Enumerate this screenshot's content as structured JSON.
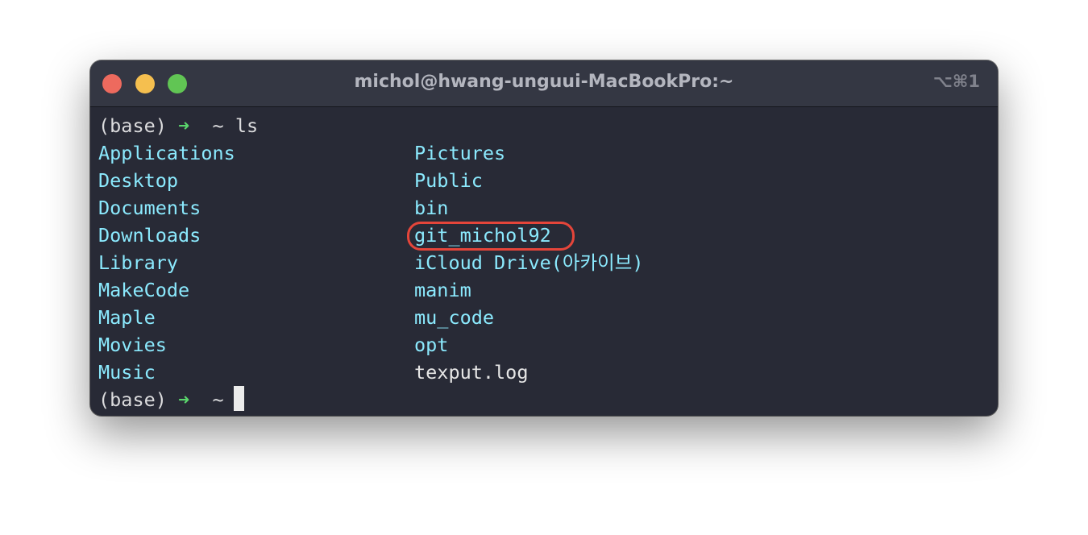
{
  "window": {
    "title": "michol@hwang-unguui-MacBookPro:~",
    "shortcut": "⌥⌘1"
  },
  "colors": {
    "background": "#282a36",
    "titlebar": "#343743",
    "directory": "#8be9fd",
    "file": "#e6e6e6",
    "prompt_arrow": "#5ad66c",
    "highlight_ring": "#e5453a",
    "traffic_close": "#ed6a5e",
    "traffic_minimize": "#f5bf4f",
    "traffic_maximize": "#61c554"
  },
  "session": {
    "prompt_env": "(base)",
    "prompt_arrow": "➜",
    "prompt_dir": "~",
    "command": "ls"
  },
  "listing": {
    "left": [
      "Applications",
      "Desktop",
      "Documents",
      "Downloads",
      "Library",
      "MakeCode",
      "Maple",
      "Movies",
      "Music"
    ],
    "right": [
      "Pictures",
      "Public",
      "bin",
      "git_michol92",
      "iCloud Drive(아카이브)",
      "manim",
      "mu_code",
      "opt",
      "texput.log"
    ]
  },
  "highlighted_entry": "git_michol92"
}
